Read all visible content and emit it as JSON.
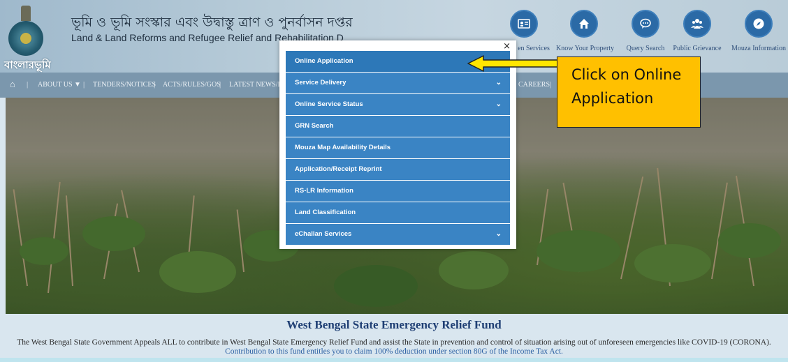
{
  "header": {
    "title_bn": "ভূমি ও ভূমি সংস্কার এবং উদ্বাস্তু ত্রাণ ও পুনর্বাসন দপ্তর",
    "title_en": "Land & Land Reforms and Refugee Relief and Rehabilitation D",
    "brand_bn": "বাংলারভূমি",
    "quick_links": [
      {
        "label": "en Services",
        "icon": "citizen-id-icon"
      },
      {
        "label": "Know Your Property",
        "icon": "home-icon"
      },
      {
        "label": "Query Search",
        "icon": "chat-bubble-icon"
      },
      {
        "label": "Public Grievance",
        "icon": "users-icon"
      },
      {
        "label": "Mouza Information",
        "icon": "compass-icon"
      }
    ]
  },
  "nav": {
    "home_icon": "home-icon",
    "items": [
      "ABOUT US",
      "TENDERS/NOTICES",
      "ACTS/RULES/GOS",
      "LATEST NEWS/EV",
      "CAREERS"
    ]
  },
  "modal": {
    "close": "×",
    "items": [
      {
        "label": "Online Application",
        "has_dropdown": false
      },
      {
        "label": "Service Delivery",
        "has_dropdown": true
      },
      {
        "label": "Online Service Status",
        "has_dropdown": true
      },
      {
        "label": "GRN Search",
        "has_dropdown": false
      },
      {
        "label": "Mouza Map Availability Details",
        "has_dropdown": false
      },
      {
        "label": "Application/Receipt Reprint",
        "has_dropdown": false
      },
      {
        "label": "RS-LR Information",
        "has_dropdown": false
      },
      {
        "label": "Land Classification",
        "has_dropdown": false
      },
      {
        "label": "eChallan Services",
        "has_dropdown": true
      }
    ]
  },
  "annotation": {
    "text": "Click on Online\nApplication",
    "color": "#ffc000"
  },
  "footer": {
    "title": "West Bengal State Emergency Relief Fund",
    "appeal": "The West Bengal State Government Appeals ALL to contribute in West Bengal State Emergency Relief Fund and assist the State in prevention and control of situation arising out of unforeseen emergencies like COVID-19 (CORONA).",
    "note": "Contribution to this fund entitles you to claim 100% deduction under section 80G of the Income Tax Act."
  }
}
